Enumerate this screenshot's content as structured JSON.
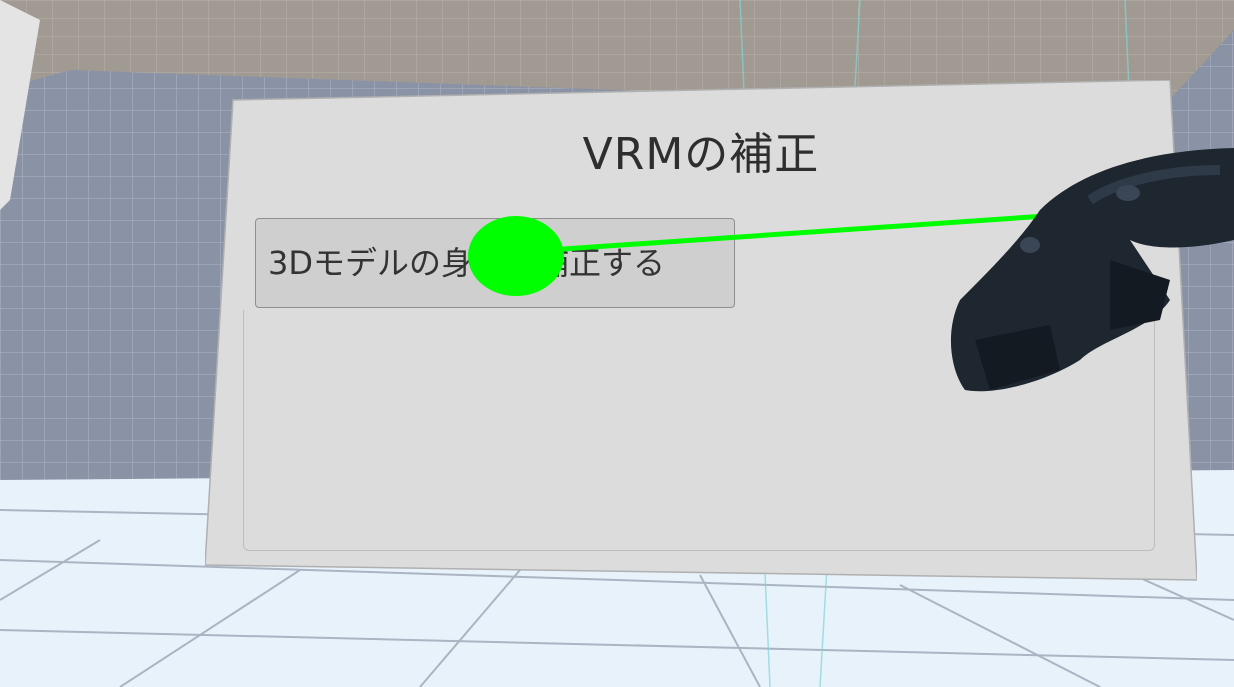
{
  "panel": {
    "title": "VRMの補正",
    "button_label": "3Dモデルの身長を補正する"
  },
  "colors": {
    "panel_bg": "#dcdcdc",
    "button_bg": "#cfcfcf",
    "pointer_laser": "#00ff00",
    "floor": "#e8f2fb",
    "wall": "#8a93a6",
    "ceiling": "#a09a93"
  },
  "icons": [
    "vr-controller-icon",
    "pointer-cursor-icon"
  ]
}
